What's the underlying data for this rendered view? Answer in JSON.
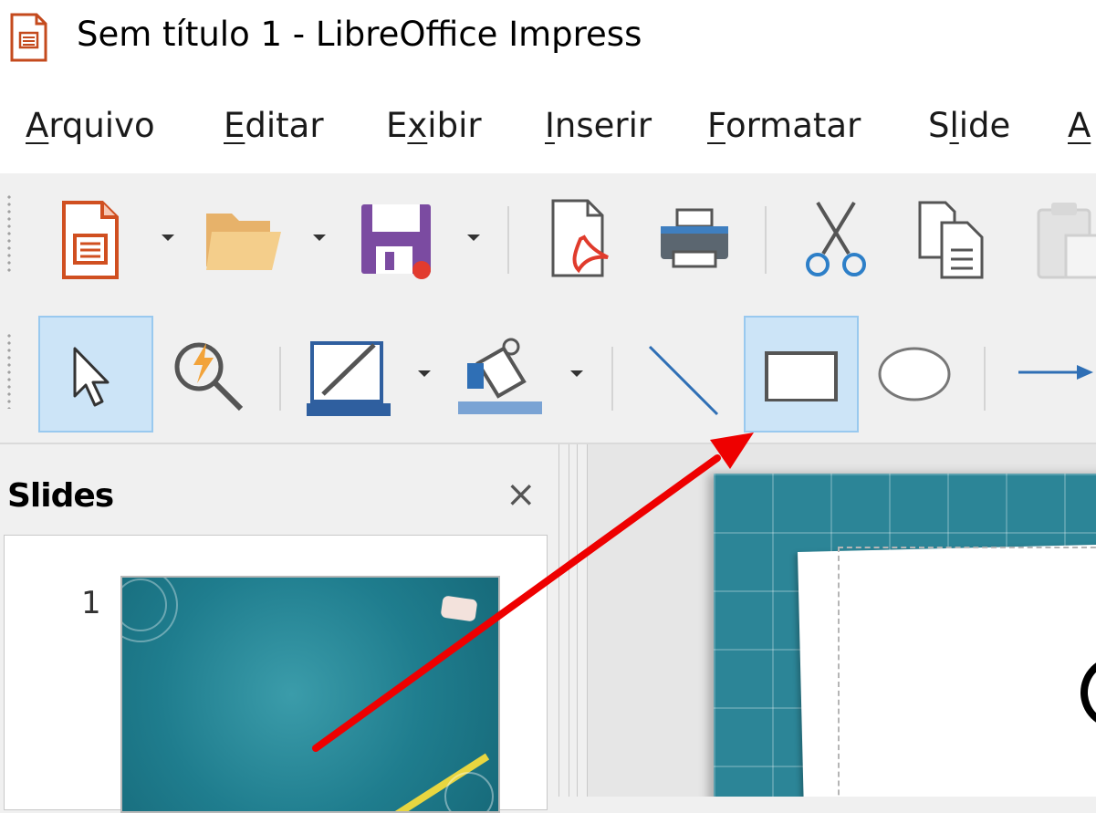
{
  "window": {
    "title": "Sem título 1 - LibreOffice Impress"
  },
  "menu": {
    "items": [
      {
        "mnemonic": "A",
        "rest": "rquivo"
      },
      {
        "mnemonic": "E",
        "rest": "ditar"
      },
      {
        "pre": "E",
        "mnemonic": "x",
        "rest": "ibir"
      },
      {
        "mnemonic": "I",
        "rest": "nserir"
      },
      {
        "mnemonic": "F",
        "rest": "ormatar"
      },
      {
        "pre": "S",
        "mnemonic": "l",
        "rest": "ide"
      },
      {
        "mnemonic": "A",
        "rest": ""
      }
    ]
  },
  "toolbar_standard": {
    "buttons": [
      "new-presentation-icon",
      "open-folder-icon",
      "save-icon",
      "export-pdf-icon",
      "print-icon",
      "cut-icon",
      "copy-icon",
      "paste-icon"
    ]
  },
  "toolbar_drawing": {
    "buttons": [
      "select-icon",
      "zoom-pan-icon",
      "line-color-icon",
      "fill-color-icon",
      "line-icon",
      "rectangle-icon",
      "ellipse-icon",
      "arrow-line-icon"
    ],
    "active": [
      "select",
      "rectangle"
    ]
  },
  "slides_panel": {
    "title": "Slides",
    "close_glyph": "×",
    "slide_number": "1"
  },
  "colors": {
    "accent_blue": "#2f5f9f",
    "active_button_bg": "#cce4f7",
    "annotation_arrow": "#ee0000",
    "slide_theme": "#2c8597"
  }
}
